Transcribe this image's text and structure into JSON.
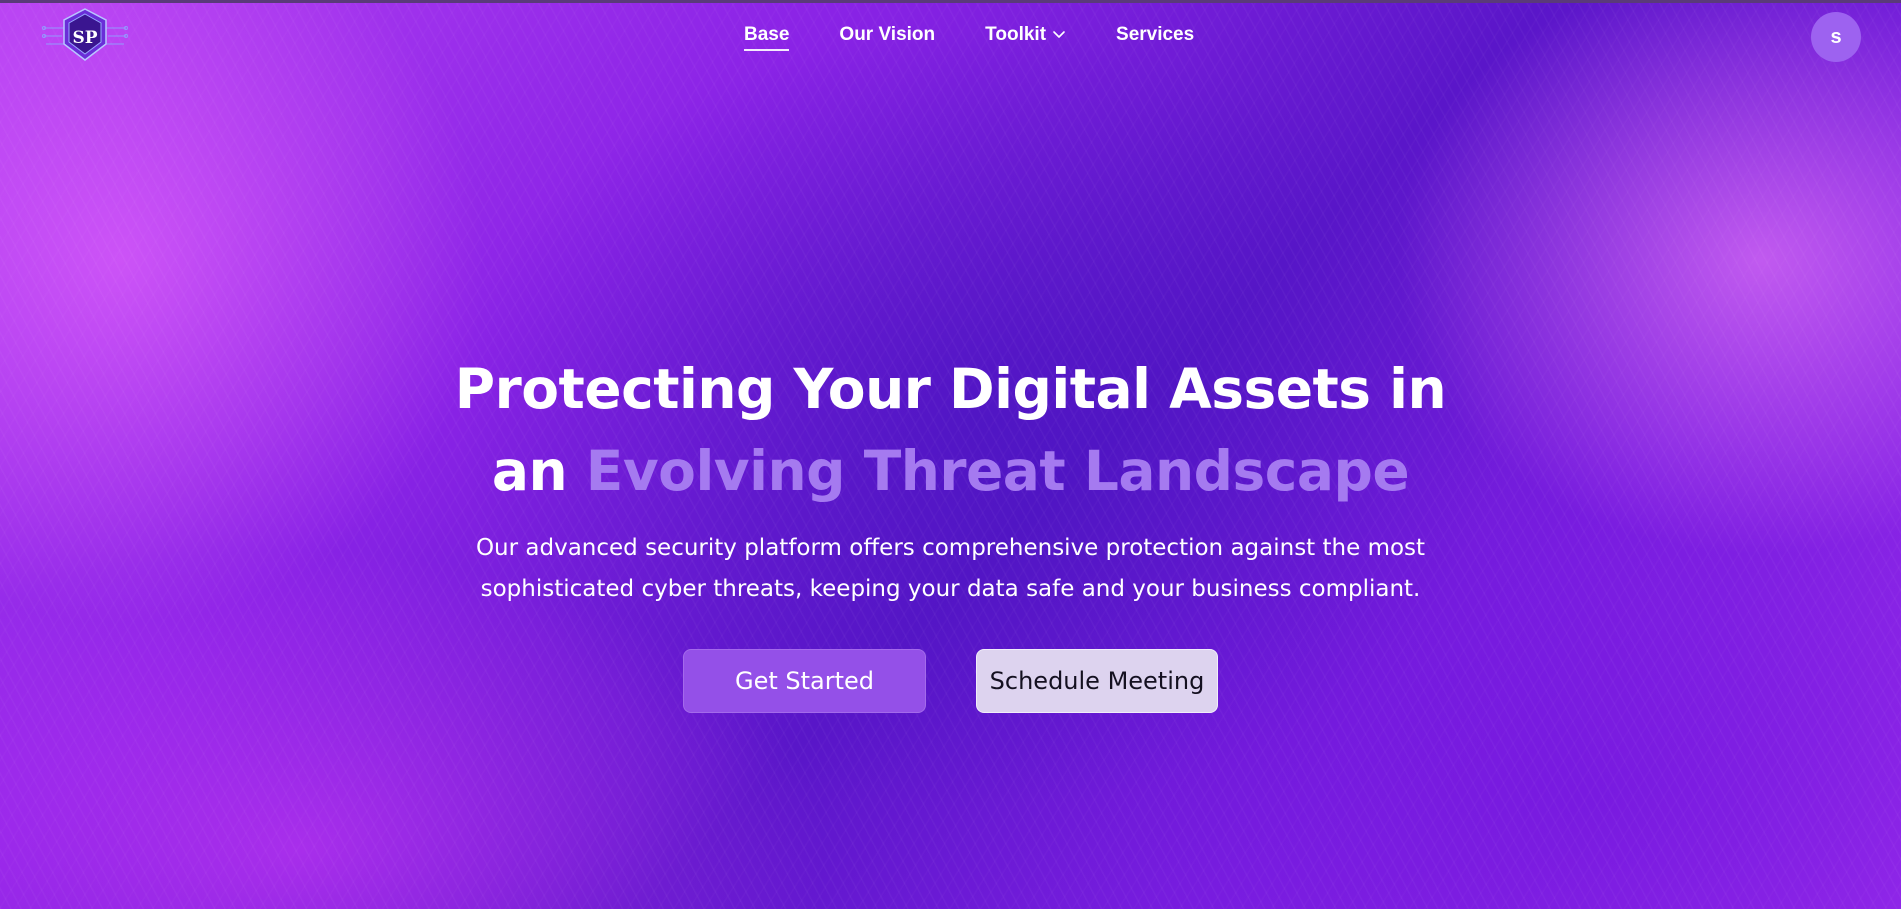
{
  "logo": {
    "text": "SP"
  },
  "nav": {
    "items": [
      {
        "label": "Base",
        "active": true
      },
      {
        "label": "Our Vision",
        "active": false
      },
      {
        "label": "Toolkit",
        "active": false,
        "has_dropdown": true
      },
      {
        "label": "Services",
        "active": false
      }
    ]
  },
  "user": {
    "avatar_initial": "s"
  },
  "hero": {
    "title_line1": "Protecting Your Digital Assets in",
    "title_line2_prefix": "an ",
    "title_line2_accent": "Evolving Threat Landscape",
    "description_line1": "Our advanced security platform offers comprehensive protection against the most",
    "description_line2": "sophisticated cyber threats, keeping your data safe and your business compliant.",
    "primary_button": "Get Started",
    "secondary_button": "Schedule Meeting"
  },
  "colors": {
    "accent": "#a57af0",
    "primary_button": "#9450e8",
    "secondary_button": "#ddd3ef",
    "avatar": "#9d62f0"
  }
}
